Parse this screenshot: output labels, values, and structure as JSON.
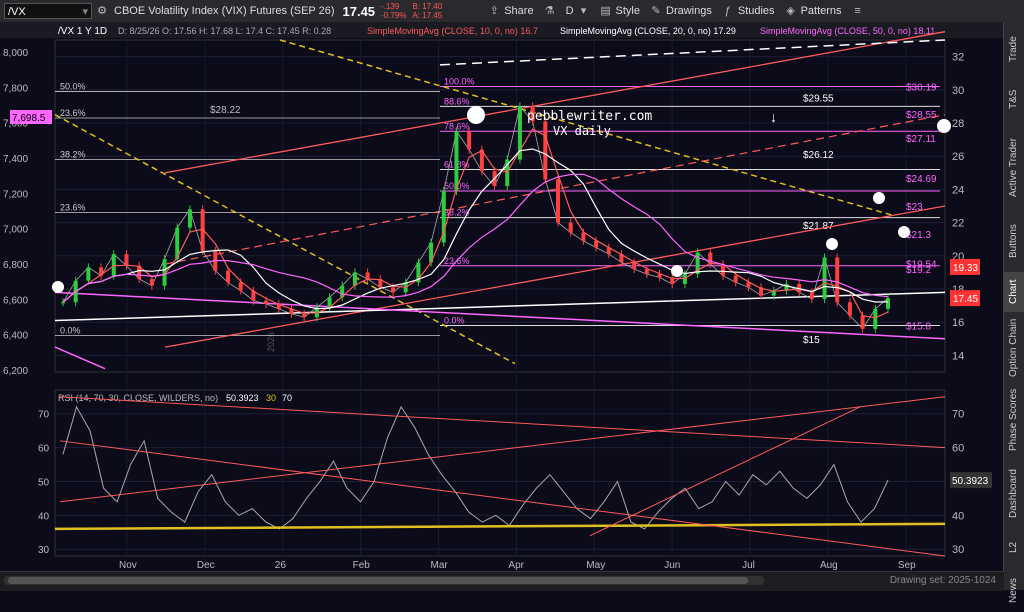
{
  "toolbar": {
    "symbol": "/VX",
    "description": "CBOE Volatility Index (VIX) Futures (SEP 26)",
    "price": "17.45",
    "change": "-.139",
    "change_pct": "-0.79%",
    "bid": "B: 17.40",
    "ask": "A: 17.45",
    "share": "Share",
    "timeframe": "D",
    "style": "Style",
    "drawings": "Drawings",
    "studies": "Studies",
    "patterns": "Patterns"
  },
  "header": {
    "title": "/VX 1 Y 1D",
    "ohlc": "D: 8/25/26  O: 17.56  H: 17.68  L: 17.4  C: 17.45  R: 0.28",
    "sma10": "SimpleMovingAvg (CLOSE, 10, 0, no) 16.7",
    "sma20": "SimpleMovingAvg (CLOSE, 20, 0, no) 17.29",
    "sma50": "SimpleMovingAvg (CLOSE, 50, 0, no) 18.11"
  },
  "rsi_header": {
    "label": "RSI (14, 70, 30, CLOSE, WILDERS, no)",
    "value": "50.3923",
    "ob": "30",
    "os": "70"
  },
  "annotations": {
    "watermark": "pebblewriter.com",
    "sub": "VX daily",
    "fib": [
      "100.0%",
      "88.6%",
      "78.6%",
      "61.8%",
      "50.0%",
      "38.2%",
      "23.6%",
      "0.0%"
    ],
    "left_fib": [
      "50.0%",
      "23.6%",
      "38.2%",
      "23.6%",
      "0.0%"
    ],
    "left_price": "7,698.5",
    "level_2822": "$28.22",
    "levels": [
      {
        "label": "$30.19",
        "v": 30.19
      },
      {
        "label": "$28.55",
        "v": 28.55
      },
      {
        "label": "$27.11",
        "v": 27.11
      },
      {
        "label": "$24.69",
        "v": 24.69
      },
      {
        "label": "$23",
        "v": 23
      },
      {
        "label": "$21.3",
        "v": 21.3
      },
      {
        "label": "$19.54",
        "v": 19.54
      },
      {
        "label": "$19.2",
        "v": 19.2
      },
      {
        "label": "$15.8",
        "v": 15.8
      }
    ],
    "inner_levels": [
      {
        "label": "$29.55",
        "v": 29.55
      },
      {
        "label": "$26.12",
        "v": 26.12
      },
      {
        "label": "$21.87",
        "v": 21.87
      },
      {
        "label": "$15",
        "v": 15
      }
    ]
  },
  "price_tags": {
    "red": "19.33",
    "last": "17.45",
    "rsi": "50.3923"
  },
  "axes": {
    "right_price": [
      "32",
      "30",
      "28",
      "26",
      "24",
      "22",
      "20",
      "18",
      "16",
      "14"
    ],
    "left_spx": [
      "8,000",
      "7,800",
      "7,600",
      "7,400",
      "7,200",
      "7,000",
      "6,800",
      "6,600",
      "6,400",
      "6,200"
    ],
    "rsi_right": [
      "70",
      "60",
      "50",
      "40",
      "30"
    ],
    "rsi_left": [
      "70",
      "60",
      "50",
      "40",
      "30"
    ],
    "x_labels": [
      "Nov",
      "Dec",
      "26",
      "Feb",
      "Mar",
      "Apr",
      "May",
      "Jun",
      "Jul",
      "Aug",
      "Sep"
    ],
    "year_marker": "2026"
  },
  "sidebar": [
    "Trade",
    "T&S",
    "Active Trader",
    "Buttons",
    "Chart",
    "Option Chain",
    "Phase Scores",
    "Dashboard",
    "L2",
    "News"
  ],
  "status": "Drawing set: 2025-1024",
  "colors": {
    "background": "#0b0b1a",
    "sma10": "#ff5b5b",
    "sma20": "#ffffff",
    "sma50": "#ff66ff",
    "spx": "#9b59ff",
    "fib": "#ff66ff",
    "yellow": "#e0c020",
    "up_candle": "#2ecc40",
    "down_candle": "#ff4040"
  },
  "chart_data": {
    "type": "line",
    "title": "/VX 1 Y 1D",
    "series": [
      {
        "name": "/VX close",
        "values": [
          17.2,
          18.5,
          19.3,
          18.8,
          20.1,
          19.4,
          18.6,
          18.2,
          19.8,
          21.7,
          22.8,
          20.3,
          19.1,
          18.4,
          17.9,
          17.3,
          17.1,
          16.8,
          16.5,
          16.3,
          16.9,
          17.5,
          18.2,
          19.0,
          18.6,
          18.1,
          17.8,
          18.4,
          19.6,
          20.8,
          23.9,
          27.5,
          26.4,
          25.1,
          24.2,
          25.8,
          29.0,
          28.1,
          24.6,
          22.0,
          21.4,
          20.9,
          20.5,
          20.1,
          19.6,
          19.2,
          18.9,
          18.7,
          18.3,
          18.9,
          20.2,
          19.5,
          18.8,
          18.4,
          18.1,
          17.6,
          17.9,
          18.3,
          17.8,
          17.4,
          19.9,
          17.2,
          16.4,
          15.6,
          16.8,
          17.45
        ]
      }
    ],
    "rsi_values": [
      58,
      72,
      65,
      48,
      44,
      55,
      62,
      45,
      41,
      38,
      47,
      52,
      44,
      40,
      42,
      38,
      36,
      39,
      45,
      50,
      56,
      48,
      44,
      50,
      63,
      72,
      66,
      58,
      52,
      47,
      41,
      38,
      40,
      37,
      43,
      48,
      52,
      47,
      42,
      39,
      44,
      50,
      38,
      36,
      41,
      45,
      48,
      42,
      44,
      50,
      46,
      52,
      49,
      53,
      48,
      45,
      49,
      55,
      44,
      38,
      42,
      50.39
    ],
    "y_range": [
      13,
      33
    ],
    "rsi_range": [
      28,
      77
    ],
    "x_categories": [
      "Nov",
      "Dec",
      "26",
      "Feb",
      "Mar",
      "Apr",
      "May",
      "Jun",
      "Jul",
      "Aug",
      "Sep"
    ]
  }
}
